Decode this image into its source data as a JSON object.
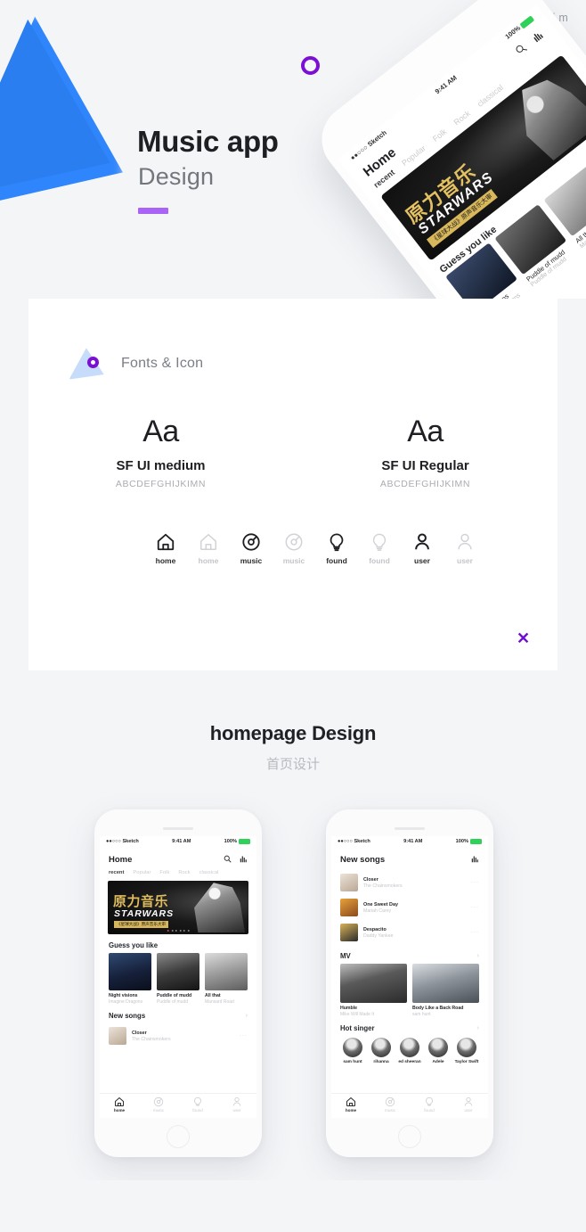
{
  "credit": "Design by lei m",
  "hero": {
    "title": "Music app",
    "subtitle": "Design"
  },
  "panel": {
    "title": "Fonts & Icon",
    "fonts": [
      {
        "sample": "Aa",
        "name": "SF UI medium",
        "alphabet": "ABCDEFGHIJKIMN"
      },
      {
        "sample": "Aa",
        "name": "SF UI Regular",
        "alphabet": "ABCDEFGHIJKIMN"
      }
    ],
    "icons": [
      {
        "label": "home",
        "state": "active"
      },
      {
        "label": "home",
        "state": "inactive"
      },
      {
        "label": "music",
        "state": "active"
      },
      {
        "label": "music",
        "state": "inactive"
      },
      {
        "label": "found",
        "state": "active"
      },
      {
        "label": "found",
        "state": "inactive"
      },
      {
        "label": "user",
        "state": "active"
      },
      {
        "label": "user",
        "state": "inactive"
      }
    ],
    "close": "✕"
  },
  "homepage": {
    "title": "homepage Design",
    "subtitle": "首页设计"
  },
  "status_bar": {
    "carrier": "●●○○○ Sketch",
    "wifi": "▼",
    "time": "9:41 AM",
    "battery_pct": "100%"
  },
  "phone_left": {
    "header_title": "Home",
    "tabs": [
      "recent",
      "Popular",
      "Folk",
      "Rock",
      "classical"
    ],
    "active_tab": "recent",
    "banner": {
      "cn_title": "原力音乐",
      "en_title": "STARWARS",
      "sub_title": "《星球大战》原声音乐大审"
    },
    "guess_title": "Guess you like",
    "guess_items": [
      {
        "title": "Night visions",
        "artist": "Imagine Dragons"
      },
      {
        "title": "Puddle of mudd",
        "artist": "Puddle of mudd"
      },
      {
        "title": "All that",
        "artist": "Mansard Road"
      }
    ],
    "newsongs_title": "New songs",
    "newsongs": [
      {
        "title": "Closer",
        "artist": "The Chainsmokers"
      }
    ],
    "tabbar": [
      "home",
      "music",
      "found",
      "user"
    ],
    "tabbar_active": "home"
  },
  "phone_right": {
    "header_title": "New songs",
    "songs": [
      {
        "title": "Closer",
        "artist": "The Chainsmokers",
        "more": "···"
      },
      {
        "title": "One Sweet Day",
        "artist": "Mariah Carey",
        "more": "···"
      },
      {
        "title": "Despacito",
        "artist": "Daddy Yankee",
        "more": "···"
      }
    ],
    "mv_title": "MV",
    "mvs": [
      {
        "title": "Humble",
        "artist": "Mike Will Made It"
      },
      {
        "title": "Body Like a Back Road",
        "artist": "sam hunt"
      }
    ],
    "singer_title": "Hot singer",
    "singers": [
      "sam hunt",
      "rihanna",
      "ed sheeran",
      "Adele",
      "Taylor Swift"
    ],
    "tabbar": [
      "home",
      "music",
      "found",
      "user"
    ],
    "tabbar_active": "home"
  },
  "colors": {
    "blue": "#2b7ef0",
    "purple": "#7b0fd4",
    "accent_bar": "#a964f7",
    "arc_blue": "#1e88e5",
    "page_bg": "#f4f5f7"
  }
}
